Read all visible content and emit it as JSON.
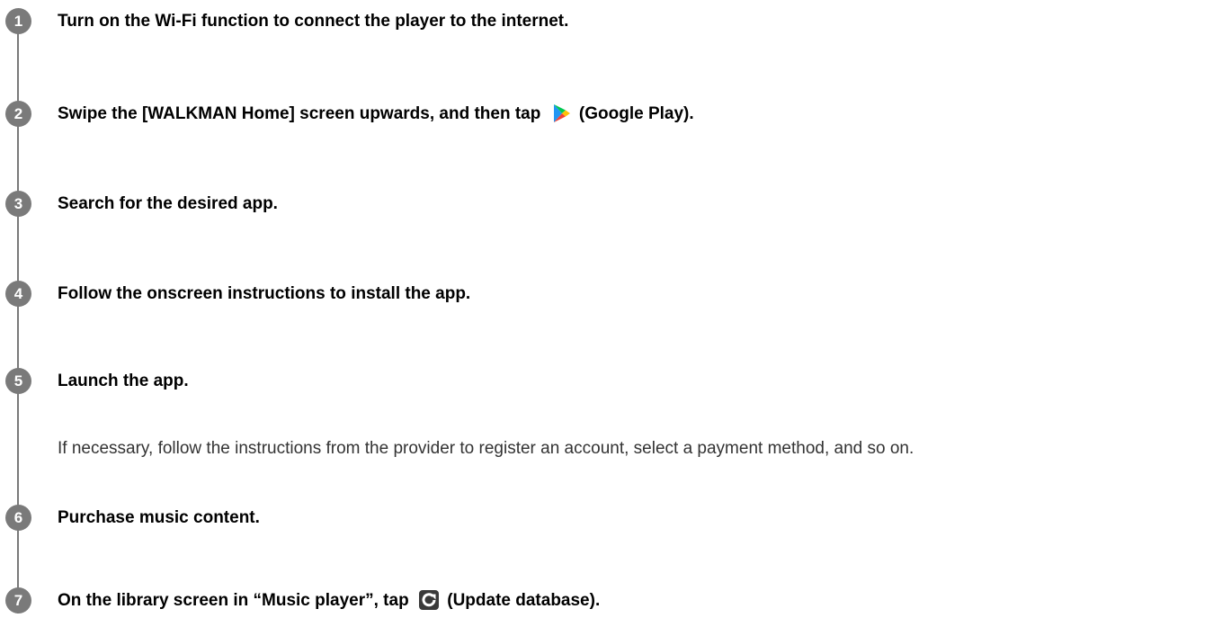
{
  "steps": [
    {
      "number": "1",
      "text": "Turn on the Wi-Fi function to connect the player to the internet."
    },
    {
      "number": "2",
      "text_before": "Swipe the [WALKMAN Home] screen upwards, and then tap",
      "icon": "google-play-icon",
      "text_after": "(Google Play)."
    },
    {
      "number": "3",
      "text": "Search for the desired app."
    },
    {
      "number": "4",
      "text": "Follow the onscreen instructions to install the app."
    },
    {
      "number": "5",
      "text": "Launch the app.",
      "note": "If necessary, follow the instructions from the provider to register an account, select a payment method, and so on."
    },
    {
      "number": "6",
      "text": "Purchase music content."
    },
    {
      "number": "7",
      "text_before": "On the library screen in “Music player”, tap",
      "icon": "update-database-icon",
      "text_after": "(Update database)."
    }
  ],
  "colors": {
    "badge": "#7a7a7a",
    "text": "#000000",
    "note": "#333333",
    "play_green": "#00c853",
    "play_blue": "#2196f3",
    "play_red": "#f44336",
    "play_yellow": "#ffc107"
  }
}
